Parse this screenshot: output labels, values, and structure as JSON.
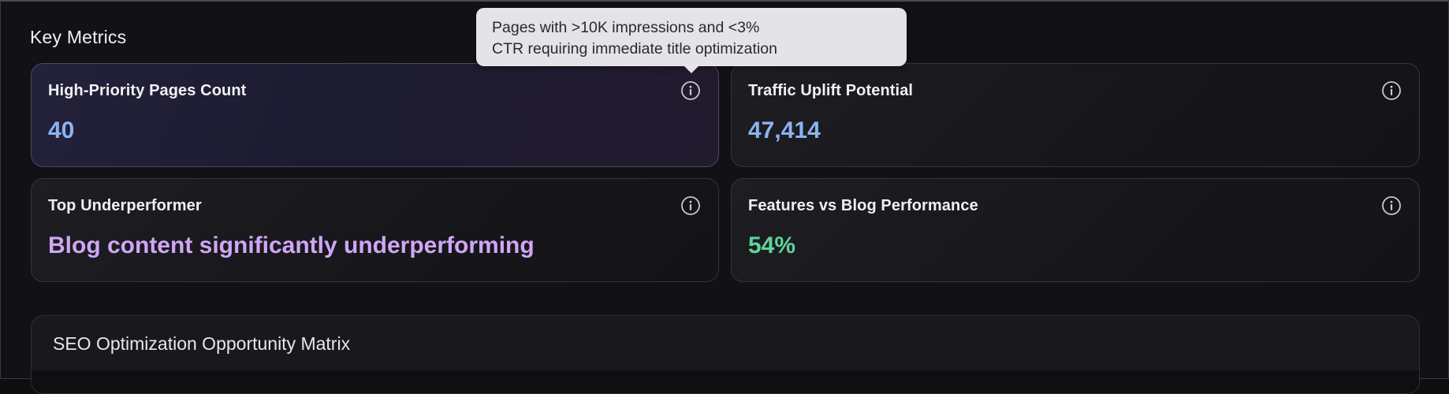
{
  "section": {
    "title": "Key Metrics"
  },
  "cards": [
    {
      "label": "High-Priority Pages Count",
      "value": "40",
      "value_color": "#8ab4f0"
    },
    {
      "label": "Traffic Uplift Potential",
      "value": "47,414",
      "value_color": "#8ab4f0"
    },
    {
      "label": "Top Underperformer",
      "value": "Blog content significantly underperforming",
      "value_color": "#d0a6f5"
    },
    {
      "label": "Features vs Blog Performance",
      "value": "54%",
      "value_color": "#5fd49a"
    }
  ],
  "tooltip": {
    "line1": "Pages with >10K impressions and <3%",
    "line2": "CTR requiring immediate title optimization"
  },
  "matrix": {
    "title": "SEO Optimization Opportunity Matrix"
  },
  "icons": {
    "info": "info-icon"
  }
}
